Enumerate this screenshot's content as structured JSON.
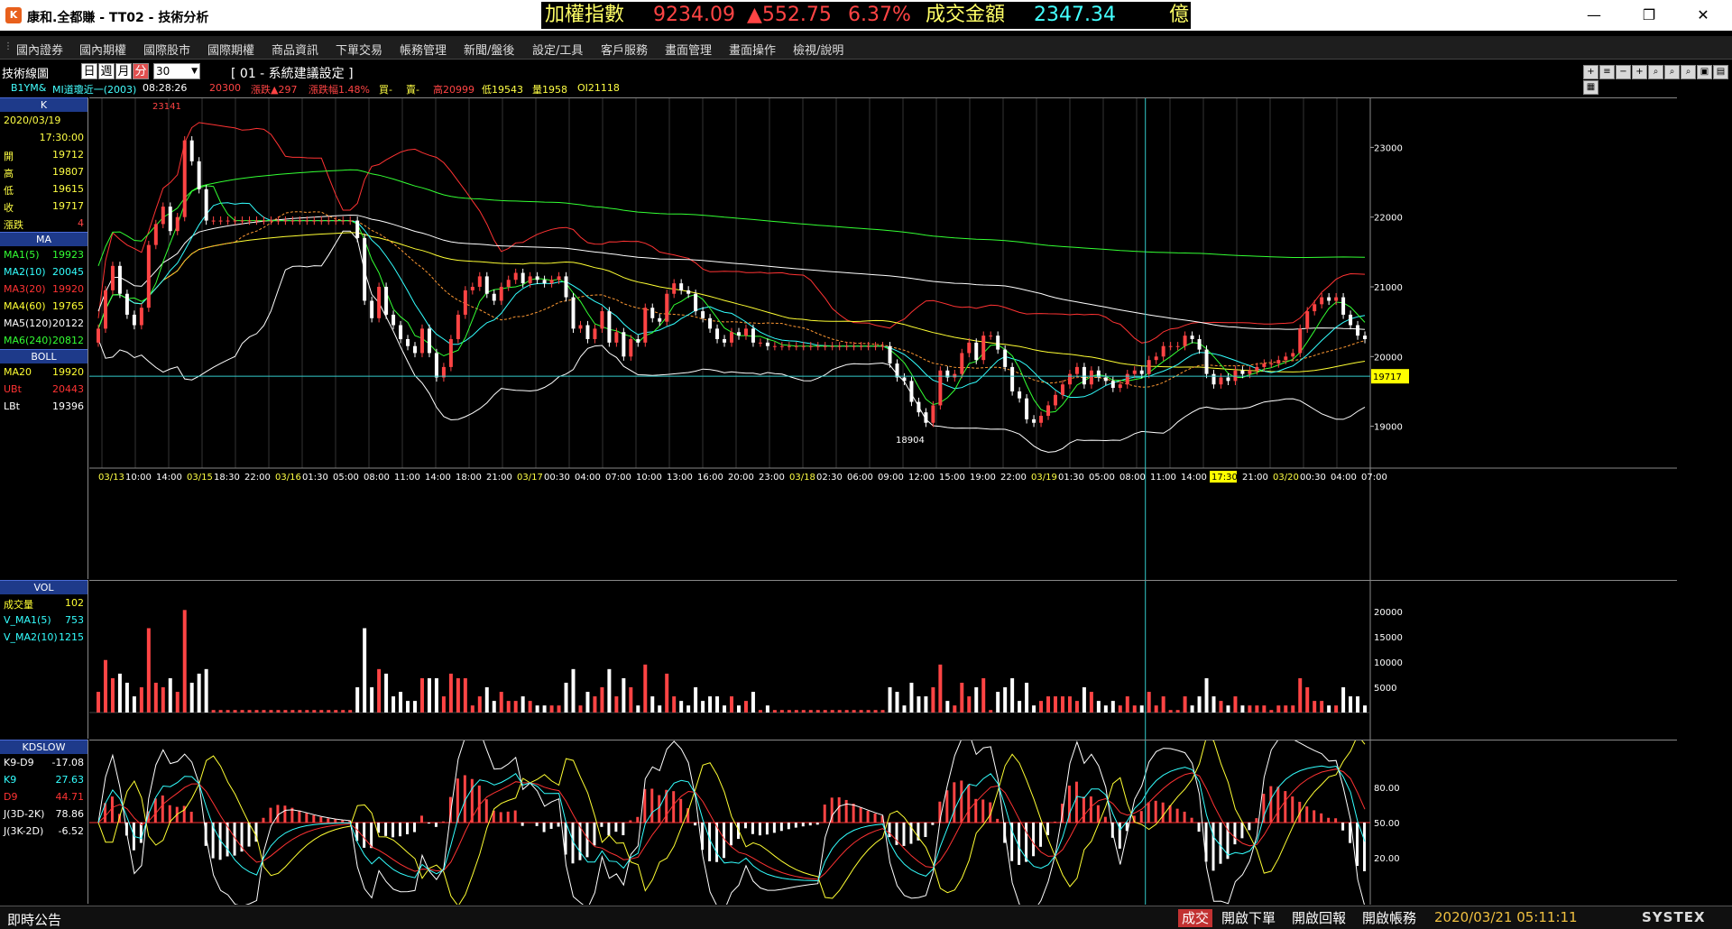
{
  "window": {
    "title": "康和.全都賺 - TT02 - 技術分析",
    "logo": "K"
  },
  "ticker": {
    "index_label": "加權指數",
    "index_value": "9234.09",
    "change": "▲552.75",
    "pct": "6.37%",
    "turnover_label": "成交金額",
    "turnover_value": "2347.34",
    "unit": "億"
  },
  "menu": [
    "國內證券",
    "國內期權",
    "國際股市",
    "國際期權",
    "商品資訊",
    "下單交易",
    "帳務管理",
    "新聞/盤後",
    "設定/工具",
    "客戶服務",
    "畫面管理",
    "畫面操作",
    "檢視/說明"
  ],
  "toolbar": {
    "label": "技術線圖",
    "periods": [
      "日",
      "週",
      "月",
      "分"
    ],
    "active_period": "分",
    "interval": "30",
    "system_setting": "[ 01 - 系統建議設定 ]"
  },
  "info": {
    "symbol": "B1YM&",
    "name": "MI道瓊近一(2003)",
    "time": "08:28:26",
    "price": "20300",
    "change": "漲跌▲297",
    "pct": "漲跌幅1.48%",
    "buy": "買-",
    "sell": "賣-",
    "high": "高20999",
    "low": "低19543",
    "volume": "量1958",
    "oi": "OI21118"
  },
  "left_k": {
    "head": "K",
    "date": "2020/03/19",
    "time": "17:30:00",
    "rows": [
      {
        "k": "開",
        "v": "19712"
      },
      {
        "k": "高",
        "v": "19807"
      },
      {
        "k": "低",
        "v": "19615"
      },
      {
        "k": "收",
        "v": "19717"
      },
      {
        "k": "漲跌",
        "v": "4"
      }
    ]
  },
  "left_ma": {
    "head": "MA",
    "rows": [
      {
        "k": "MA1(5)",
        "v": "19923",
        "color": "#33ff33"
      },
      {
        "k": "MA2(10)",
        "v": "20045",
        "color": "#33ffff"
      },
      {
        "k": "MA3(20)",
        "v": "19920",
        "color": "#ff3333"
      },
      {
        "k": "MA4(60)",
        "v": "19765",
        "color": "#ffff33"
      },
      {
        "k": "MA5(120)",
        "v": "20122",
        "color": "#ffffff"
      },
      {
        "k": "MA6(240)",
        "v": "20812",
        "color": "#33ff33"
      }
    ]
  },
  "left_boll": {
    "head": "BOLL",
    "rows": [
      {
        "k": "MA20",
        "v": "19920",
        "color": "#ffff33"
      },
      {
        "k": "UBt",
        "v": "20443",
        "color": "#ff3333"
      },
      {
        "k": "LBt",
        "v": "19396",
        "color": "#ffffff"
      }
    ]
  },
  "left_vol": {
    "head": "VOL",
    "rows": [
      {
        "k": "成交量",
        "v": "102",
        "color": "#ffff33"
      },
      {
        "k": "V_MA1(5)",
        "v": "753",
        "color": "#33ffff"
      },
      {
        "k": "V_MA2(10)",
        "v": "1215",
        "color": "#33ffff"
      }
    ]
  },
  "left_kd": {
    "head": "KDSLOW",
    "rows": [
      {
        "k": "K9-D9",
        "v": "-17.08",
        "color": "#ffffff"
      },
      {
        "k": "K9",
        "v": "27.63",
        "color": "#33ffff"
      },
      {
        "k": "D9",
        "v": "44.71",
        "color": "#ff3333"
      },
      {
        "k": "J(3D-2K)",
        "v": "78.86",
        "color": "#ffffff"
      },
      {
        "k": "J(3K-2D)",
        "v": "-6.52",
        "color": "#ffffff"
      }
    ]
  },
  "chart_data": {
    "type": "candlestick",
    "price_axis": {
      "ticks": [
        "23000",
        "22000",
        "21000",
        "20000",
        "19000"
      ],
      "ylim": [
        18400,
        23600
      ]
    },
    "last_price_label": "19717",
    "high_label": "23141",
    "low_label": "18904",
    "x_ticks": [
      "03/13",
      "10:00",
      "14:00",
      "03/15",
      "18:30",
      "22:00",
      "03/16",
      "01:30",
      "05:00",
      "08:00",
      "11:00",
      "14:00",
      "18:00",
      "21:00",
      "03/17",
      "00:30",
      "04:00",
      "07:00",
      "10:00",
      "13:00",
      "16:00",
      "20:00",
      "23:00",
      "03/18",
      "02:30",
      "06:00",
      "09:00",
      "12:00",
      "15:00",
      "19:00",
      "22:00",
      "03/19",
      "01:30",
      "05:00",
      "08:00",
      "11:00",
      "14:00",
      "17:30",
      "21:00",
      "03/20",
      "00:30",
      "04:00",
      "07:00"
    ],
    "cursor_label": "17:30",
    "close": [
      20400,
      20950,
      21300,
      20900,
      20600,
      20450,
      20700,
      21600,
      21900,
      22150,
      21800,
      22000,
      23100,
      22800,
      22400,
      21950,
      21950,
      21950,
      21950,
      21950,
      21950,
      21950,
      21950,
      21950,
      21950,
      21950,
      21950,
      21950,
      21950,
      21950,
      21950,
      21950,
      21950,
      21950,
      21950,
      21950,
      21700,
      20800,
      20550,
      21000,
      20600,
      20450,
      20250,
      20150,
      20050,
      20400,
      20050,
      19700,
      19850,
      20250,
      20600,
      20950,
      21000,
      21150,
      20900,
      20800,
      21000,
      21100,
      21200,
      21050,
      21150,
      21100,
      21050,
      21100,
      21150,
      20850,
      20400,
      20450,
      20250,
      20400,
      20650,
      20200,
      20350,
      20000,
      20250,
      20200,
      20700,
      20550,
      20500,
      20900,
      21050,
      20950,
      20900,
      20650,
      20550,
      20400,
      20250,
      20200,
      20350,
      20300,
      20400,
      20200,
      20200,
      20150,
      20150,
      20150,
      20150,
      20150,
      20150,
      20150,
      20150,
      20150,
      20150,
      20150,
      20150,
      20150,
      20150,
      20150,
      20150,
      20150,
      19900,
      19700,
      19650,
      19350,
      19200,
      19050,
      19300,
      19800,
      19700,
      19750,
      20050,
      20200,
      19950,
      20300,
      20300,
      20100,
      19850,
      19500,
      19400,
      19100,
      19050,
      19150,
      19300,
      19450,
      19600,
      19750,
      19850,
      19600,
      19800,
      19700,
      19650,
      19550,
      19600,
      19750,
      19800,
      19750,
      19950,
      20000,
      20150,
      20150,
      20150,
      20300,
      20250,
      20100,
      19750,
      19600,
      19700,
      19650,
      19800,
      19750,
      19800,
      19850,
      19900,
      19900,
      19950,
      20000,
      20050,
      20400,
      20650,
      20750,
      20850,
      20800,
      20850,
      20600,
      20450,
      20300,
      20250
    ],
    "volume_axis": {
      "ticks": [
        "20000",
        "15000",
        "10000",
        "5000"
      ],
      "ylim": [
        0,
        25000
      ]
    },
    "kd_axis": {
      "ticks": [
        "80.00",
        "50.00",
        "20.00"
      ],
      "ylim": [
        -20,
        120
      ]
    }
  }
}
